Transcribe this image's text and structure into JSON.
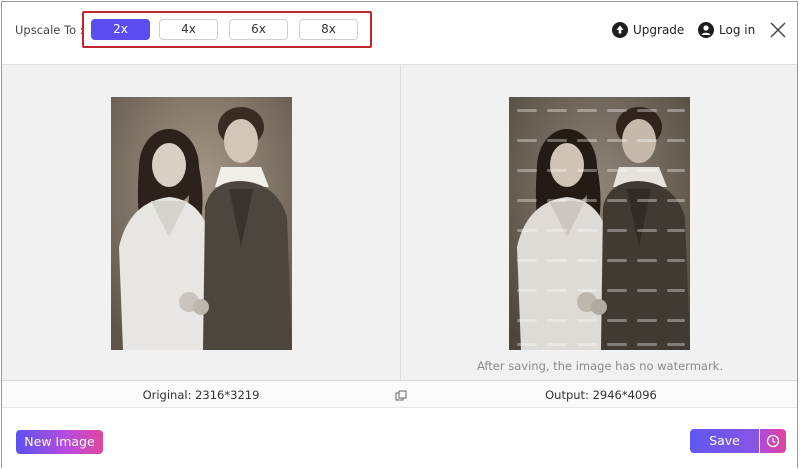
{
  "header": {
    "upscale_label": "Upscale To :",
    "scales": [
      "2x",
      "4x",
      "6x",
      "8x"
    ],
    "selected_scale": "2x",
    "upgrade_label": "Upgrade",
    "login_label": "Log in"
  },
  "preview": {
    "watermark_note": "After saving, the image has no watermark."
  },
  "info": {
    "original_label": "Original: 2316*3219",
    "output_label": "Output: 2946*4096"
  },
  "footer": {
    "new_image_label": "New Image",
    "save_label": "Save"
  },
  "colors": {
    "accent": "#5a4cf0",
    "highlight_border": "#c0272d",
    "gradient_pink": "#e0479f"
  }
}
